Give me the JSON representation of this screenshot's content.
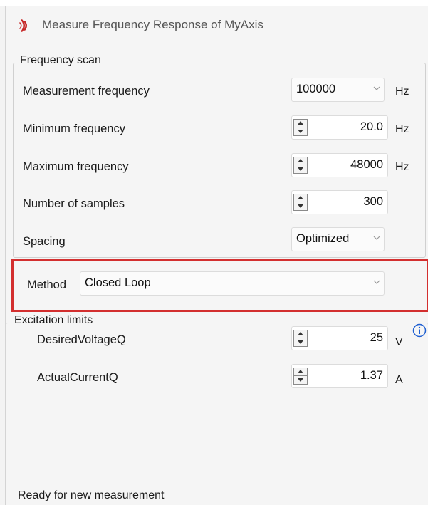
{
  "window": {
    "title": "Measure Frequency Response of MyAxis",
    "icon": "app-logo-icon",
    "accent_color": "#c62828"
  },
  "frequency_scan": {
    "title": "Frequency scan",
    "measurement_frequency": {
      "label": "Measurement frequency",
      "value": "100000",
      "unit": "Hz"
    },
    "minimum_frequency": {
      "label": "Minimum frequency",
      "value": "20.0",
      "unit": "Hz"
    },
    "maximum_frequency": {
      "label": "Maximum frequency",
      "value": "48000",
      "unit": "Hz"
    },
    "number_of_samples": {
      "label": "Number of samples",
      "value": "300"
    },
    "spacing": {
      "label": "Spacing",
      "value": "Optimized"
    }
  },
  "method": {
    "label": "Method",
    "value": "Closed Loop",
    "highlight_color": "#d32f2f"
  },
  "excitation_limits": {
    "title": "Excitation limits",
    "desired_voltage": {
      "label": "DesiredVoltageQ",
      "value": "25",
      "unit": "V"
    },
    "actual_current": {
      "label": "ActualCurrentQ",
      "value": "1.37",
      "unit": "A"
    },
    "info_icon": "info-icon",
    "info_color": "#1e5fd1"
  },
  "status": {
    "text": "Ready for new measurement"
  }
}
